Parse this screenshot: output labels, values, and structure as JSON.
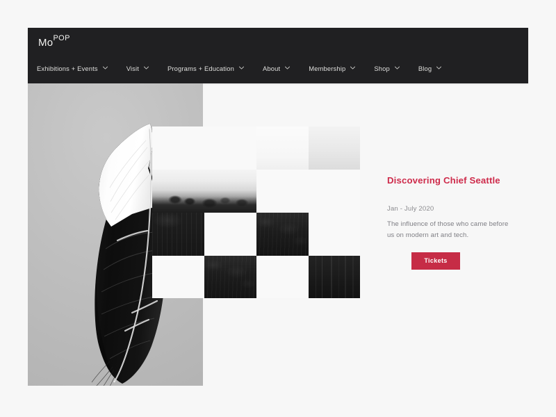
{
  "site": {
    "background_color": "#f7f7f7"
  },
  "navbar": {
    "background_color": "#202022",
    "logo": {
      "primary": "Mo",
      "superscript": "POP"
    },
    "items": [
      {
        "label": "Exhibitions + Events",
        "icon": "chevron-down-icon",
        "has_dropdown": true
      },
      {
        "label": "Visit",
        "icon": "chevron-down-icon",
        "has_dropdown": true
      },
      {
        "label": "Programs + Education",
        "icon": "chevron-down-icon",
        "has_dropdown": true
      },
      {
        "label": "About",
        "icon": "chevron-down-icon",
        "has_dropdown": true
      },
      {
        "label": "Membership",
        "icon": "chevron-down-icon",
        "has_dropdown": true
      },
      {
        "label": "Shop",
        "icon": "chevron-down-icon",
        "has_dropdown": true
      },
      {
        "label": "Blog",
        "icon": "chevron-down-icon",
        "has_dropdown": true
      }
    ]
  },
  "hero": {
    "feather_image_alt": "black and white feather",
    "mosaic": {
      "columns": 4,
      "rows": 4,
      "cells": [
        {
          "row": 1,
          "col": 1,
          "kind": "light"
        },
        {
          "row": 1,
          "col": 2,
          "kind": "light"
        },
        {
          "row": 1,
          "col": 3,
          "kind": "haze-a"
        },
        {
          "row": 1,
          "col": 4,
          "kind": "haze-b"
        },
        {
          "row": 2,
          "col": 1,
          "kind": "mist"
        },
        {
          "row": 2,
          "col": 2,
          "kind": "mist"
        },
        {
          "row": 2,
          "col": 3,
          "kind": "light"
        },
        {
          "row": 2,
          "col": 4,
          "kind": "light"
        },
        {
          "row": 3,
          "col": 1,
          "kind": "ridge"
        },
        {
          "row": 3,
          "col": 2,
          "kind": "light"
        },
        {
          "row": 3,
          "col": 3,
          "kind": "forest"
        },
        {
          "row": 3,
          "col": 4,
          "kind": "light"
        },
        {
          "row": 4,
          "col": 1,
          "kind": "light"
        },
        {
          "row": 4,
          "col": 2,
          "kind": "forest"
        },
        {
          "row": 4,
          "col": 3,
          "kind": "light"
        },
        {
          "row": 4,
          "col": 4,
          "kind": "trunks"
        }
      ]
    }
  },
  "content": {
    "title": "Discovering Chief Seattle",
    "title_color": "#ce2b4b",
    "date": "Jan - July 2020",
    "description": "The influence of those who came before us on modern art and tech.",
    "cta_label": "Tickets",
    "cta_color": "#c62c46"
  }
}
